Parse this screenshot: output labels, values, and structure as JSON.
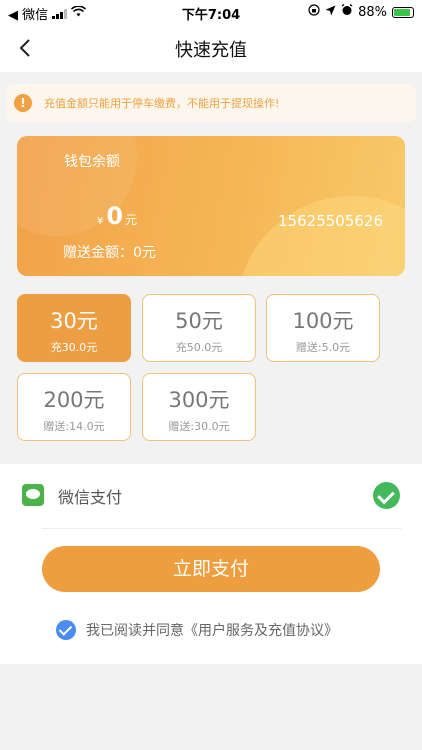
{
  "status_bar": {
    "back_app": "◀ 微信",
    "time": "下午7:04",
    "battery": "88%"
  },
  "nav": {
    "title": "快速充值"
  },
  "notice": {
    "icon": "!",
    "text": "充值金额只能用于停车缴费，不能用于提现操作!"
  },
  "wallet": {
    "label": "钱包余额",
    "currency": "¥",
    "balance": "0",
    "unit": "元",
    "phone": "15625505626",
    "gift": "赠送金额：0元"
  },
  "options": [
    {
      "amount": "30元",
      "sub": "充30.0元",
      "selected": true
    },
    {
      "amount": "50元",
      "sub": "充50.0元",
      "selected": false
    },
    {
      "amount": "100元",
      "sub": "赠送:5.0元",
      "selected": false
    },
    {
      "amount": "200元",
      "sub": "赠送:14.0元",
      "selected": false
    },
    {
      "amount": "300元",
      "sub": "赠送:30.0元",
      "selected": false
    }
  ],
  "payment": {
    "method": "微信支付",
    "button": "立即支付",
    "agreement": "我已阅读并同意《用户服务及充值协议》"
  },
  "colors": {
    "accent": "#ee9e42",
    "wechat_green": "#4cb24a",
    "check_green": "#43b95c",
    "agree_blue": "#4a8cf0"
  }
}
